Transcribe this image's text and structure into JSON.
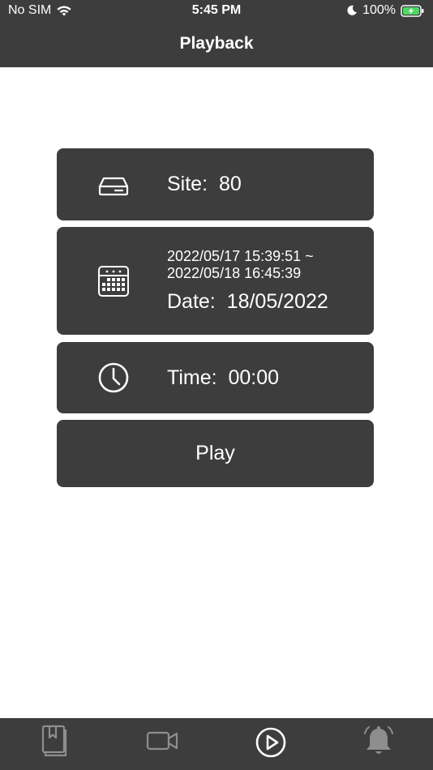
{
  "status_bar": {
    "carrier": "No SIM",
    "time": "5:45 PM",
    "battery": "100%"
  },
  "header": {
    "title": "Playback"
  },
  "cards": {
    "site": {
      "label": "Site:",
      "value": "80",
      "icon": "hard-drive-icon"
    },
    "date": {
      "range_start": "2022/05/17 15:39:51 ~",
      "range_end": "2022/05/18 16:45:39",
      "label": "Date:",
      "value": "18/05/2022",
      "icon": "calendar-icon"
    },
    "time": {
      "label": "Time:",
      "value": "00:00",
      "icon": "clock-icon"
    },
    "play": {
      "label": "Play"
    }
  },
  "tabbar": {
    "items": [
      {
        "name": "bookmarks",
        "icon": "bookmark-book-icon",
        "active": false
      },
      {
        "name": "live",
        "icon": "video-camera-icon",
        "active": false
      },
      {
        "name": "playback",
        "icon": "play-circle-icon",
        "active": true
      },
      {
        "name": "alarms",
        "icon": "bell-icon",
        "active": false
      }
    ]
  },
  "colors": {
    "bar_background": "#3d3d3d",
    "card_background": "#3d3d3d",
    "text": "#ffffff",
    "inactive_tab": "#8e8e8e",
    "active_tab": "#ffffff",
    "battery_charging": "#4cd964"
  }
}
